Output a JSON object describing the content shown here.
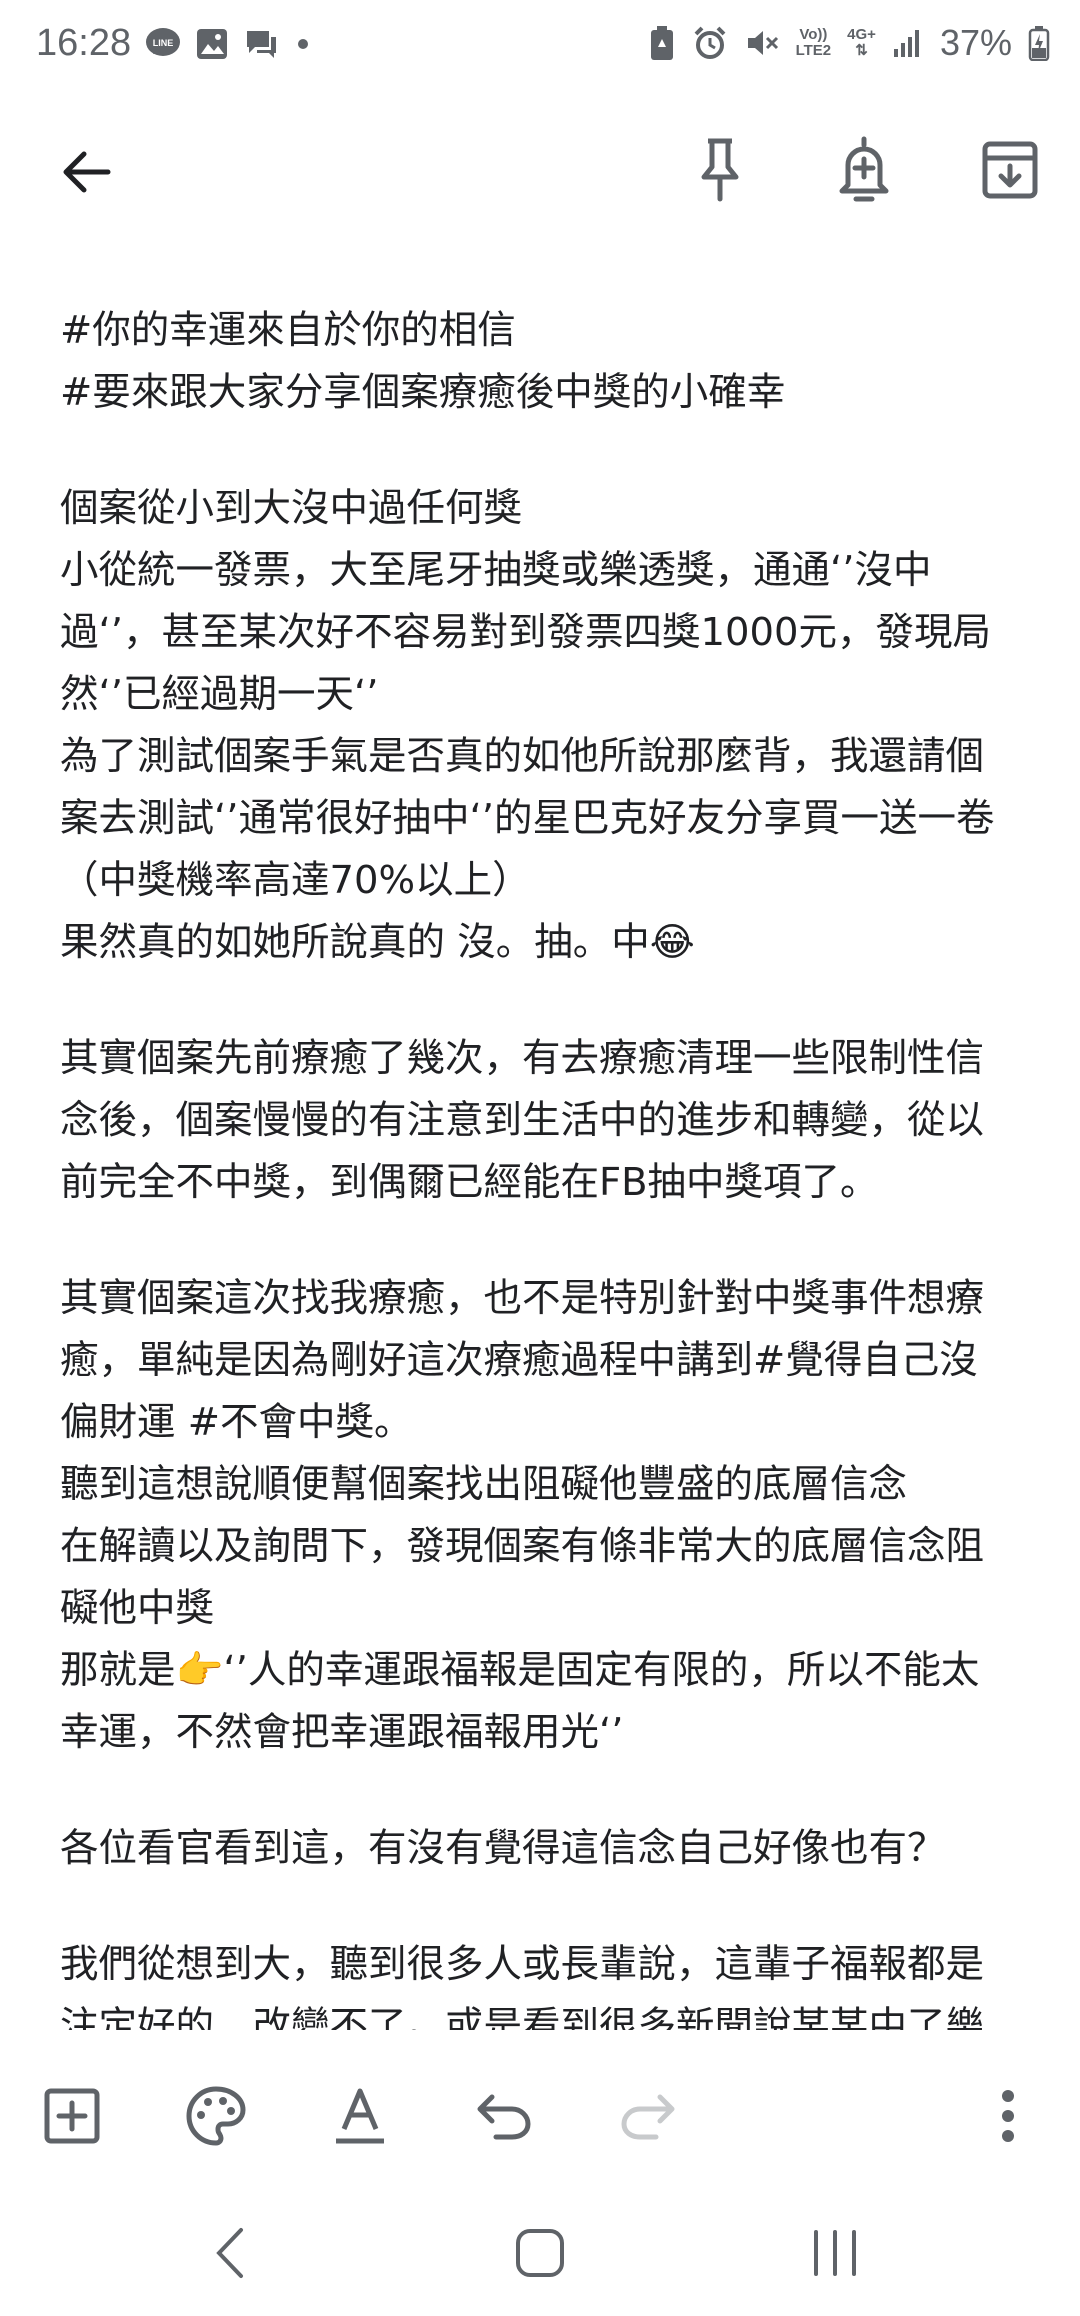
{
  "status_bar": {
    "time": "16:28",
    "network_top": "Vo))",
    "network_bottom": "LTE2",
    "network_type": "4G+",
    "battery": "37%"
  },
  "toolbar": {
    "back_icon": "arrow-left-icon",
    "pin_icon": "pin-icon",
    "reminder_icon": "bell-plus-icon",
    "archive_icon": "archive-icon"
  },
  "note": {
    "lines": [
      "#你的幸運來自於你的相信",
      "#要來跟大家分享個案療癒後中獎的小確幸",
      "",
      "個案從小到大沒中過任何獎",
      "小從統一發票，大至尾牙抽獎或樂透獎，通通‘’沒中",
      "過‘’，甚至某次好不容易對到發票四獎1000元，發現局",
      "然‘’已經過期一天‘’",
      "為了測試個案手氣是否真的如他所說那麼背，我還請個",
      "案去測試‘’通常很好抽中‘’的星巴克好友分享買一送一卷",
      "（中獎機率高達70%以上）",
      "果然真的如她所說真的 沒。抽。中😂",
      "",
      "其實個案先前療癒了幾次，有去療癒清理一些限制性信",
      "念後，個案慢慢的有注意到生活中的進步和轉變，從以",
      "前完全不中獎，到偶爾已經能在FB抽中獎項了。",
      "",
      "其實個案這次找我療癒，也不是特別針對中獎事件想療",
      "癒，單純是因為剛好這次療癒過程中講到#覺得自己沒",
      "偏財運 #不會中獎。",
      "聽到這想說順便幫個案找出阻礙他豐盛的底層信念",
      "在解讀以及詢問下，發現個案有條非常大的底層信念阻",
      "礙他中獎",
      "那就是👉‘’人的幸運跟福報是固定有限的，所以不能太",
      "幸運，不然會把幸運跟福報用光‘’",
      "",
      "各位看官看到這，有沒有覺得這信念自己好像也有？",
      "",
      "我們從想到大，聽到很多人或長輩說，這輩子福報都是",
      "注定好的，改變不了。或是看到很多新聞說某某中了樂"
    ]
  },
  "bottom_toolbar": {
    "add_icon": "add-box-icon",
    "palette_icon": "palette-icon",
    "text_format_icon": "text-format-icon",
    "undo_icon": "undo-icon",
    "redo_icon": "redo-icon",
    "more_icon": "more-vert-icon"
  },
  "nav_bar": {
    "back_icon": "nav-back-icon",
    "home_icon": "nav-home-icon",
    "recents_icon": "nav-recents-icon"
  },
  "colors": {
    "text": "#202124",
    "icon": "#5f6368",
    "disabled": "#c8cacc",
    "background": "#ffffff"
  }
}
